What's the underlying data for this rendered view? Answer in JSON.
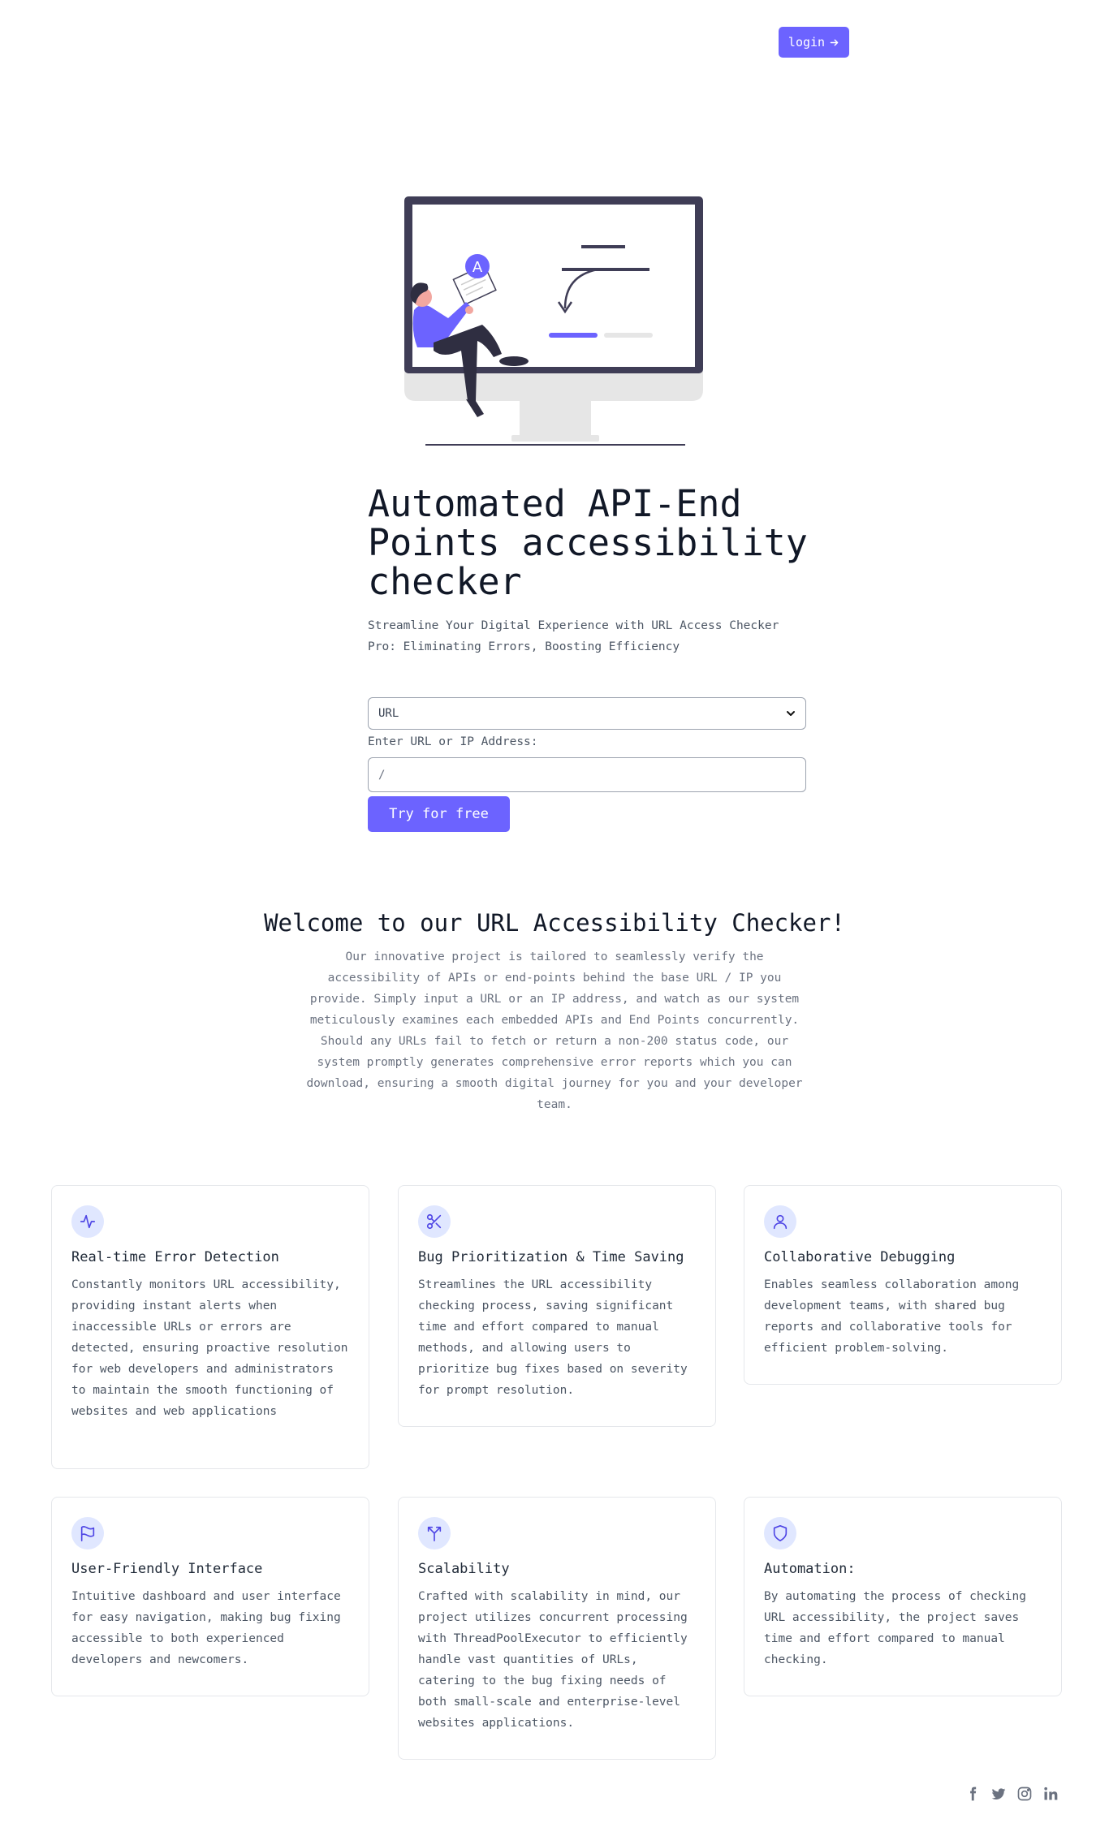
{
  "header": {
    "login_label": "login"
  },
  "hero": {
    "title": "Automated API-End Points accessibility checker",
    "subtitle": "Streamline Your Digital Experience with URL Access Checker Pro: Eliminating Errors, Boosting Efficiency",
    "illustration_badge": "A"
  },
  "form": {
    "select_value": "URL",
    "input_label": "Enter URL or IP Address:",
    "input_value": "/",
    "submit_label": "Try for free"
  },
  "welcome": {
    "title": "Welcome to our URL Accessibility Checker!",
    "text": "Our innovative project is tailored to seamlessly verify the accessibility of APIs or end-points behind the base URL / IP you provide. Simply input a URL or an IP address, and watch as our system meticulously examines each embedded APIs and End Points concurrently. Should any URLs fail to fetch or return a non-200 status code, our system promptly generates comprehensive error reports which you can download, ensuring a smooth digital journey for you and your developer team."
  },
  "features": [
    {
      "icon": "activity-icon",
      "title": "Real-time Error Detection",
      "description": "Constantly monitors URL accessibility, providing instant alerts when inaccessible URLs or errors are detected, ensuring proactive resolution for web developers and administrators to maintain the smooth functioning of websites and web applications"
    },
    {
      "icon": "scissors-icon",
      "title": "Bug Prioritization & Time Saving",
      "description": "Streamlines the URL accessibility checking process, saving significant time and effort compared to manual methods, and allowing users to prioritize bug fixes based on severity for prompt resolution."
    },
    {
      "icon": "user-icon",
      "title": "Collaborative Debugging",
      "description": "Enables seamless collaboration among development teams, with shared bug reports and collaborative tools for efficient problem-solving."
    },
    {
      "icon": "flag-icon",
      "title": "User-Friendly Interface",
      "description": "Intuitive dashboard and user interface for easy navigation, making bug fixing accessible to both experienced developers and newcomers."
    },
    {
      "icon": "split-arrow-icon",
      "title": "Scalability",
      "description": "Crafted with scalability in mind, our project utilizes concurrent processing with ThreadPoolExecutor to efficiently handle vast quantities of URLs, catering to the bug fixing needs of both small-scale and enterprise-level websites applications."
    },
    {
      "icon": "shield-icon",
      "title": "Automation:",
      "description": "By automating the process of checking URL accessibility, the project saves time and effort compared to manual checking."
    }
  ],
  "socials": [
    "facebook-icon",
    "twitter-icon",
    "instagram-icon",
    "linkedin-icon"
  ],
  "colors": {
    "accent": "#6c63ff",
    "icon_bg": "#e0e7ff",
    "text": "#1f2937",
    "muted": "#6b7280"
  }
}
